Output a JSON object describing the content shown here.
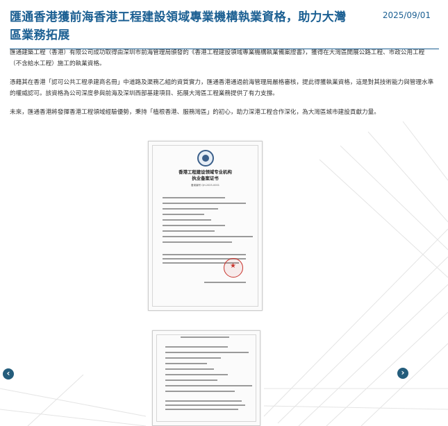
{
  "article": {
    "title": "匯通香港獲前海香港工程建設領域專業機構執業資格，助力大灣區業務拓展",
    "date": "2025/09/01",
    "paragraphs": [
      "匯通建築工程（香港）有限公司成功取得由深圳市前海管理局頒發的《香港工程建設領域專業機構執業備案證書》，獲得在大灣區開展公路工程、市政公用工程（不含給水工程）施工的執業資格。",
      "憑藉其在香港「認可公共工程承建商名冊」中道路及渠務乙組的資質實力，匯通香港通過前海管理局嚴格審核，提此得獲執業資格，這是對其技術能力與管理水準的權威認可。該資格為公司深度參與前海及深圳西部基建項目、拓展大灣區工程業務提供了有力支撐。",
      "未來，匯通香港將發揮香港工程領域經驗優勢，秉持「植根香港、服務灣區」的初心，助力深港工程合作深化，為大灣區城市建設貢獻力量。"
    ]
  },
  "certificate": {
    "title_line1": "香港工程建设领域专业机构",
    "title_line2": "执业备案证书",
    "number": "备案编号 QH-2025-0001"
  },
  "slider": {
    "prev_label": "‹",
    "next_label": "›"
  },
  "colors": {
    "accent": "#1b5f92",
    "nav": "#245d7c",
    "stamp": "#c9352e"
  }
}
